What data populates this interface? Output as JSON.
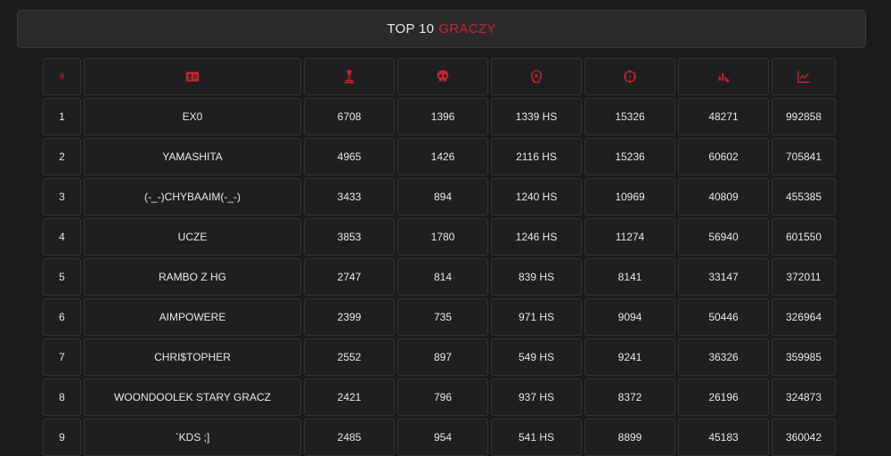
{
  "title": {
    "main": "TOP 10",
    "accent": "GRACZY"
  },
  "colors": {
    "accent": "#c4262e",
    "background": "#1b1b1d",
    "cell": "#1f1f22"
  },
  "header": {
    "rank_symbol": "#",
    "icons": [
      "id-card-icon",
      "trophy-icon",
      "skull-icon",
      "headshot-icon",
      "crosshair-icon",
      "damage-icon",
      "chart-line-icon"
    ]
  },
  "rows": [
    {
      "rank": "1",
      "name": "EX0",
      "c1": "6708",
      "c2": "1396",
      "hs": "1339 HS",
      "c4": "15326",
      "c5": "48271",
      "c6": "992858"
    },
    {
      "rank": "2",
      "name": "YAMASHITA",
      "c1": "4965",
      "c2": "1426",
      "hs": "2116 HS",
      "c4": "15236",
      "c5": "60602",
      "c6": "705841"
    },
    {
      "rank": "3",
      "name": "(-_-)CHYBAAIM(-_-)",
      "c1": "3433",
      "c2": "894",
      "hs": "1240 HS",
      "c4": "10969",
      "c5": "40809",
      "c6": "455385"
    },
    {
      "rank": "4",
      "name": "UCZE",
      "c1": "3853",
      "c2": "1780",
      "hs": "1246 HS",
      "c4": "11274",
      "c5": "56940",
      "c6": "601550"
    },
    {
      "rank": "5",
      "name": "RAMBO Z HG",
      "c1": "2747",
      "c2": "814",
      "hs": "839 HS",
      "c4": "8141",
      "c5": "33147",
      "c6": "372011"
    },
    {
      "rank": "6",
      "name": "AIMPOWERE",
      "c1": "2399",
      "c2": "735",
      "hs": "971 HS",
      "c4": "9094",
      "c5": "50446",
      "c6": "326964"
    },
    {
      "rank": "7",
      "name": "CHRI$TOPHER",
      "c1": "2552",
      "c2": "897",
      "hs": "549 HS",
      "c4": "9241",
      "c5": "36326",
      "c6": "359985"
    },
    {
      "rank": "8",
      "name": "WOONDOOLEK STARY GRACZ",
      "c1": "2421",
      "c2": "796",
      "hs": "937 HS",
      "c4": "8372",
      "c5": "26196",
      "c6": "324873"
    },
    {
      "rank": "9",
      "name": "`KDS ;]",
      "c1": "2485",
      "c2": "954",
      "hs": "541 HS",
      "c4": "8899",
      "c5": "45183",
      "c6": "360042"
    }
  ]
}
